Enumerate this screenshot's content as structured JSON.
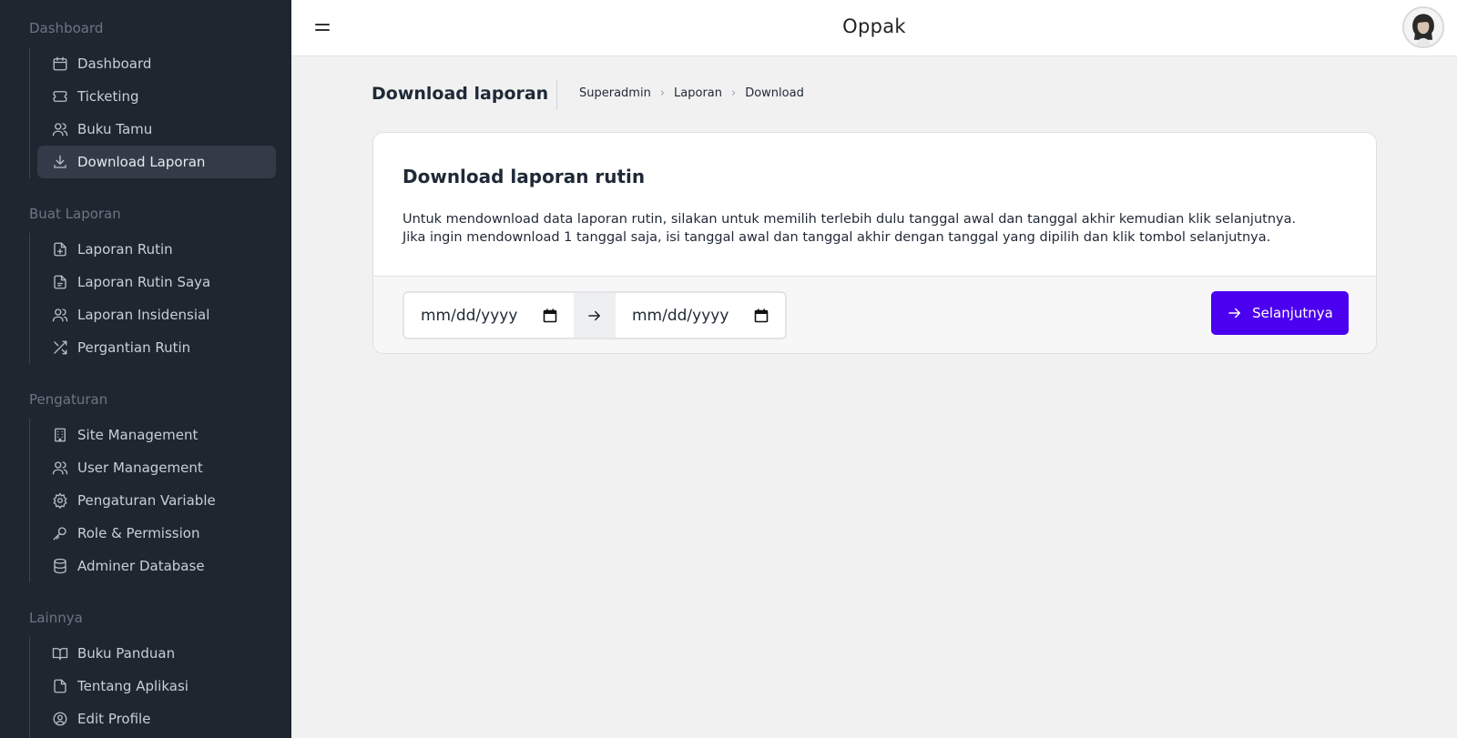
{
  "app": {
    "title": "Oppak"
  },
  "sidebar": {
    "sections": [
      {
        "heading": "Dashboard",
        "items": [
          {
            "label": "Dashboard",
            "icon": "calendar-icon",
            "active": false
          },
          {
            "label": "Ticketing",
            "icon": "ticket-icon",
            "active": false
          },
          {
            "label": "Buku Tamu",
            "icon": "users-icon",
            "active": false
          },
          {
            "label": "Download Laporan",
            "icon": "download-icon",
            "active": true
          }
        ]
      },
      {
        "heading": "Buat Laporan",
        "items": [
          {
            "label": "Laporan Rutin",
            "icon": "file-plus-icon",
            "active": false
          },
          {
            "label": "Laporan Rutin Saya",
            "icon": "file-text-icon",
            "active": false
          },
          {
            "label": "Laporan Insidensial",
            "icon": "users-icon",
            "active": false
          },
          {
            "label": "Pergantian Rutin",
            "icon": "shuffle-icon",
            "active": false
          }
        ]
      },
      {
        "heading": "Pengaturan",
        "items": [
          {
            "label": "Site Management",
            "icon": "building-icon",
            "active": false
          },
          {
            "label": "User Management",
            "icon": "users-icon",
            "active": false
          },
          {
            "label": "Pengaturan Variable",
            "icon": "gear-icon",
            "active": false
          },
          {
            "label": "Role & Permission",
            "icon": "key-icon",
            "active": false
          },
          {
            "label": "Adminer Database",
            "icon": "database-icon",
            "active": false
          }
        ]
      },
      {
        "heading": "Lainnya",
        "items": [
          {
            "label": "Buku Panduan",
            "icon": "book-icon",
            "active": false
          },
          {
            "label": "Tentang Aplikasi",
            "icon": "file-icon",
            "active": false
          },
          {
            "label": "Edit Profile",
            "icon": "user-circle-icon",
            "active": false
          }
        ]
      }
    ]
  },
  "page": {
    "title": "Download laporan",
    "breadcrumb": [
      "Superadmin",
      "Laporan",
      "Download"
    ]
  },
  "card": {
    "title": "Download laporan rutin",
    "description_line1": "Untuk mendownload data laporan rutin, silakan untuk memilih terlebih dulu tanggal awal dan tanggal akhir kemudian klik selanjutnya.",
    "description_line2": "Jika ingin mendownload 1 tanggal saja, isi tanggal awal dan tanggal akhir dengan tanggal yang dipilih dan klik tombol selanjutnya.",
    "start_date_placeholder": "mm/dd/yyyy",
    "end_date_placeholder": "mm/dd/yyyy",
    "next_button": "Selanjutnya"
  },
  "colors": {
    "sidebar_bg": "#1f2630",
    "accent": "#4c00f0",
    "page_bg": "#f1f1f1"
  }
}
